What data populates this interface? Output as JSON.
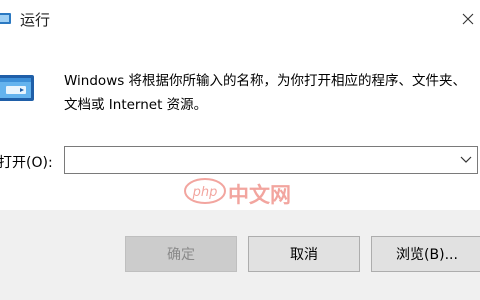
{
  "window": {
    "title": "运行",
    "close_icon": "close-icon"
  },
  "dialog": {
    "icon": "run-dialog-icon",
    "description": "Windows 将根据你所输入的名称，为你打开相应的程序、文件夹、文档或 Internet 资源。",
    "open_label": "打开(O):",
    "open_value": "",
    "dropdown_icon": "chevron-down-icon"
  },
  "buttons": {
    "ok": "确定",
    "cancel": "取消",
    "browse": "浏览(B)..."
  },
  "watermark": {
    "logo_text": "php",
    "text": "中文网"
  },
  "colors": {
    "accent": "#0078d7",
    "footer_bg": "#f0f0f0",
    "watermark": "#e33a2c"
  }
}
